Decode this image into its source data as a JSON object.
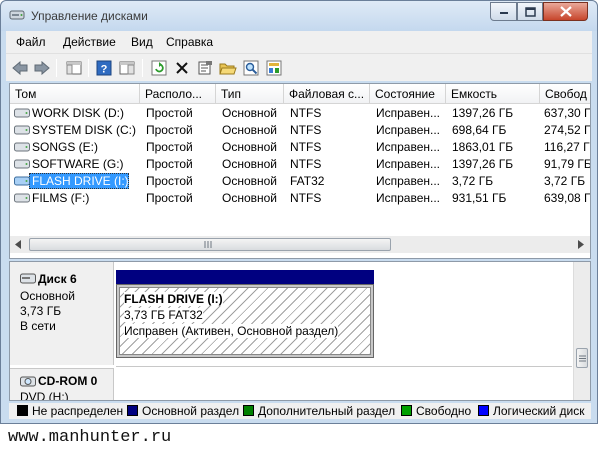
{
  "window": {
    "title": "Управление дисками"
  },
  "menu": [
    "Файл",
    "Действие",
    "Вид",
    "Справка"
  ],
  "toolbar": {
    "icons": [
      "back-arrow-icon",
      "forward-arrow-icon",
      "show-hide-tree-icon",
      "help-icon",
      "properties-view-icon",
      "refresh-icon",
      "delete-icon",
      "properties-icon",
      "open-folder-icon",
      "search-icon",
      "export-icon"
    ]
  },
  "volumes": {
    "columns": [
      "Том",
      "Располо...",
      "Тип",
      "Файловая с...",
      "Состояние",
      "Емкость",
      "Свобод"
    ],
    "rows": [
      [
        "WORK DISK (D:)",
        "Простой",
        "Основной",
        "NTFS",
        "Исправен...",
        "1397,26 ГБ",
        "637,30 ГБ"
      ],
      [
        "SYSTEM DISK (C:)",
        "Простой",
        "Основной",
        "NTFS",
        "Исправен...",
        "698,64 ГБ",
        "274,52 ГБ"
      ],
      [
        "SONGS (E:)",
        "Простой",
        "Основной",
        "NTFS",
        "Исправен...",
        "1863,01 ГБ",
        "116,27 ГБ"
      ],
      [
        "SOFTWARE (G:)",
        "Простой",
        "Основной",
        "NTFS",
        "Исправен...",
        "1397,26 ГБ",
        "91,79 ГБ"
      ],
      [
        "FLASH DRIVE (I:)",
        "Простой",
        "Основной",
        "FAT32",
        "Исправен...",
        "3,72 ГБ",
        "3,72 ГБ"
      ],
      [
        "FILMS (F:)",
        "Простой",
        "Основной",
        "NTFS",
        "Исправен...",
        "931,51 ГБ",
        "639,08 ГБ"
      ]
    ],
    "selected_index": 4
  },
  "disks": {
    "disk6": {
      "name": "Диск 6",
      "type": "Основной",
      "size": "3,73 ГБ",
      "status": "В сети",
      "partition": {
        "name": "FLASH DRIVE  (I:)",
        "size_fs": "3,73 ГБ FAT32",
        "status": "Исправен (Активен, Основной раздел)"
      }
    },
    "cdrom0": {
      "name": "CD-ROM 0",
      "type": "DVD (H:)"
    }
  },
  "legend": [
    {
      "label": "Не распределен",
      "color": "#000000"
    },
    {
      "label": "Основной раздел",
      "color": "#000080"
    },
    {
      "label": "Дополнительный раздел",
      "color": "#008000"
    },
    {
      "label": "Свободно",
      "color": "#00a000"
    },
    {
      "label": "Логический диск",
      "color": "#0000ff"
    }
  ],
  "footer": "www.manhunter.ru"
}
